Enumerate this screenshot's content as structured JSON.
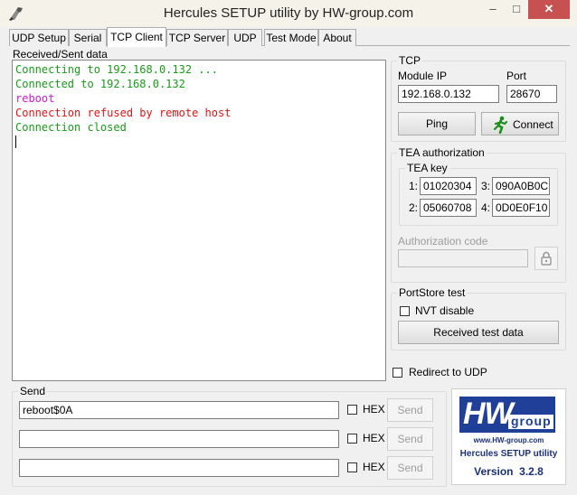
{
  "window": {
    "title": "Hercules SETUP utility by HW-group.com"
  },
  "titlebar_buttons": {
    "minimize": "–",
    "maximize": "□",
    "close": "✕"
  },
  "tabs": [
    "UDP Setup",
    "Serial",
    "TCP Client",
    "TCP Server",
    "UDP",
    "Test Mode",
    "About"
  ],
  "active_tab": "TCP Client",
  "received": {
    "label": "Received/Sent data",
    "lines": [
      {
        "text": "Connecting to 192.168.0.132 ...",
        "color": "#1a9a1a"
      },
      {
        "text": "Connected to 192.168.0.132",
        "color": "#1a9a1a"
      },
      {
        "text": "reboot",
        "color": "#d21ad2"
      },
      {
        "text": "Connection refused by remote host",
        "color": "#e01414"
      },
      {
        "text": "Connection closed",
        "color": "#1a9a1a"
      }
    ]
  },
  "tcp": {
    "group_title": "TCP",
    "module_ip_label": "Module IP",
    "module_ip": "192.168.0.132",
    "port_label": "Port",
    "port": "28670",
    "ping_label": "Ping",
    "connect_label": "Connect"
  },
  "tea": {
    "group_title": "TEA authorization",
    "key_title": "TEA key",
    "keys": [
      {
        "num": "1:",
        "value": "01020304"
      },
      {
        "num": "3:",
        "value": "090A0B0C"
      },
      {
        "num": "2:",
        "value": "05060708"
      },
      {
        "num": "4:",
        "value": "0D0E0F10"
      }
    ],
    "auth_code_label": "Authorization code",
    "auth_code_value": ""
  },
  "portstore": {
    "group_title": "PortStore test",
    "nvt_label": "NVT disable",
    "received_test_label": "Received test data"
  },
  "redirect_label": "Redirect to UDP",
  "send": {
    "group_title": "Send",
    "rows": [
      {
        "value": "reboot$0A",
        "hex_label": "HEX",
        "send_label": "Send"
      },
      {
        "value": "",
        "hex_label": "HEX",
        "send_label": "Send"
      },
      {
        "value": "",
        "hex_label": "HEX",
        "send_label": "Send"
      }
    ]
  },
  "logo": {
    "brand_hw": "HW",
    "brand_group": "group",
    "url": "www.HW-group.com",
    "product": "Hercules SETUP utility",
    "version": "Version  3.2.8"
  },
  "colors": {
    "accent_blue": "#1a3b8f",
    "logo_blue": "#1f3f99",
    "logo_text": "#1a2f7a"
  }
}
